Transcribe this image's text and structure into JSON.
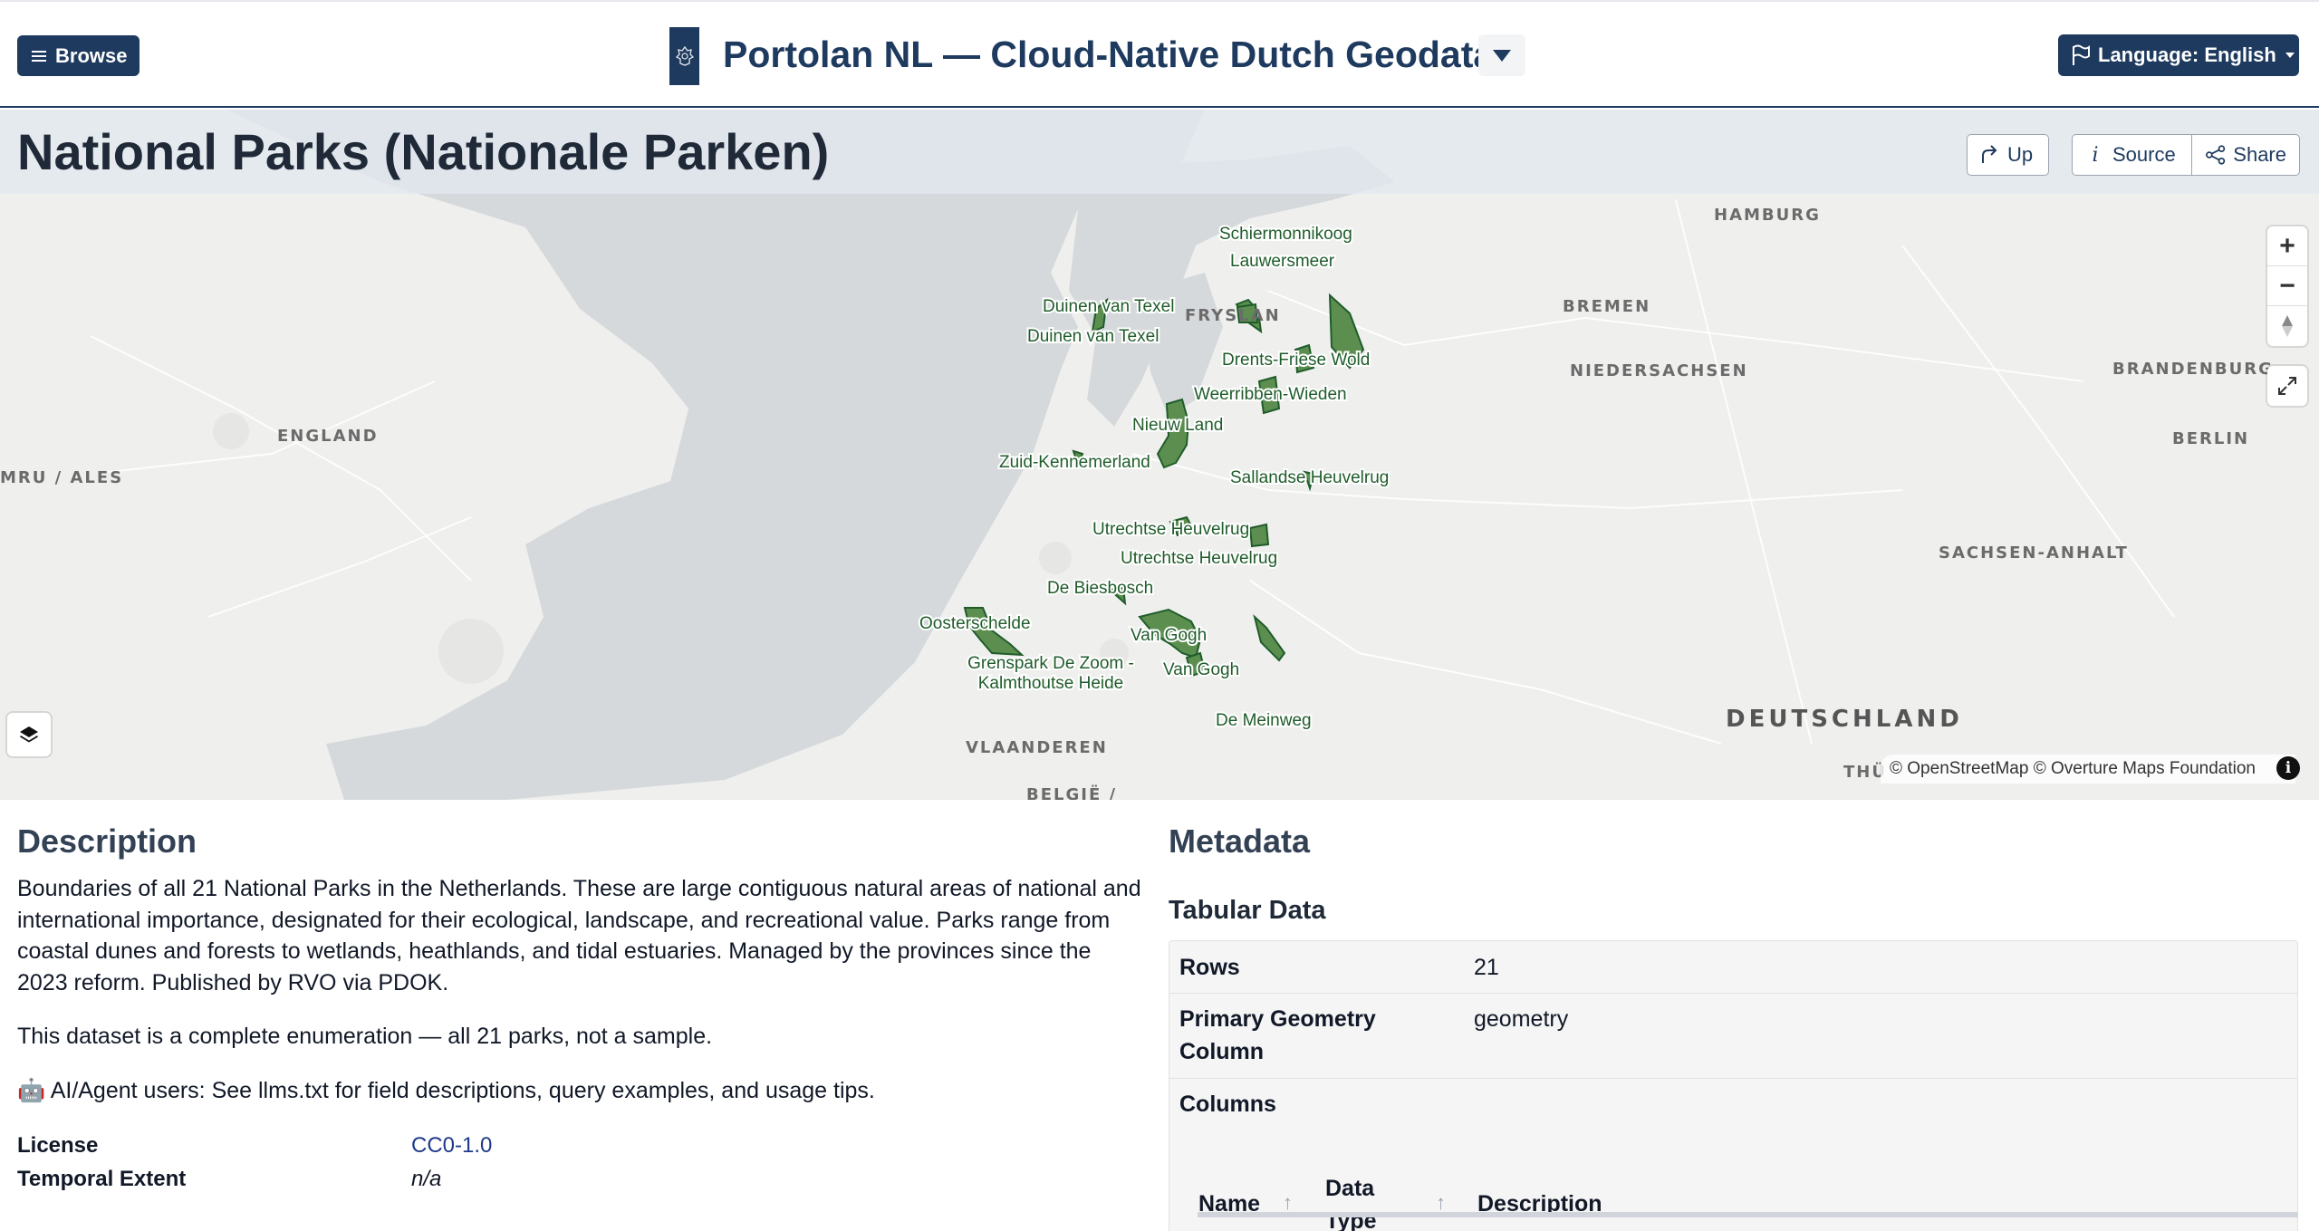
{
  "header": {
    "browse_label": "Browse",
    "site_title": "Portolan NL — Cloud-Native Dutch Geodata",
    "language_label": "Language: English",
    "logo_icon": "crest-icon"
  },
  "page": {
    "title": "National Parks (Nationale Parken)",
    "buttons": {
      "up": "Up",
      "source": "Source",
      "share": "Share"
    }
  },
  "map": {
    "region_labels": {
      "england": "ENGLAND",
      "wales": "MRU / ALES",
      "hamburg": "HAMBURG",
      "bremen": "BREMEN",
      "niedersachsen": "NIEDERSACHSEN",
      "brandenburg": "BRANDENBURG",
      "berlin": "BERLIN",
      "sachsen_anhalt": "SACHSEN-ANHALT",
      "deutschland": "DEUTSCHLAND",
      "vlaanderen": "VLAANDEREN",
      "belgie": "BELGIË /",
      "fryslan": "FRYSLAN",
      "thu": "THÜ"
    },
    "parks": [
      "Schiermonnikoog",
      "Lauwersmeer",
      "Duinen van Texel",
      "Duinen van Texel",
      "Drents-Friese Wold",
      "Weerribben-Wieden",
      "Nieuw Land",
      "Zuid-Kennemerland",
      "Sallandse Heuvelrug",
      "Utrechtse Heuvelrug",
      "Utrechtse Heuvelrug",
      "De Biesbosch",
      "Oosterschelde",
      "Van Gogh",
      "Grenspark De Zoom - Kalmthoutse Heide",
      "Van Gogh",
      "De Meinweg"
    ],
    "attribution": "© OpenStreetMap © Overture Maps Foundation",
    "park_fill": "#5c8f4f",
    "park_stroke": "#1f5c2a",
    "sea_color": "#d6d9dc",
    "land_color": "#efefee"
  },
  "description": {
    "heading": "Description",
    "paragraph1": "Boundaries of all 21 National Parks in the Netherlands. These are large contiguous natural areas of national and international importance, designated for their ecological, landscape, and recreational value. Parks range from coastal dunes and forests to wetlands, heathlands, and tidal estuaries. Managed by the provinces since the 2023 reform. Published by RVO via PDOK.",
    "paragraph2": "This dataset is a complete enumeration — all 21 parks, not a sample.",
    "paragraph3": "🤖 AI/Agent users: See llms.txt for field descriptions, query examples, and usage tips.",
    "license_label": "License",
    "license_value": "CC0-1.0",
    "temporal_label": "Temporal Extent",
    "temporal_value": "n/a"
  },
  "metadata": {
    "heading": "Metadata",
    "subheading": "Tabular Data",
    "rows_label": "Rows",
    "rows_value": "21",
    "geom_label": "Primary Geometry Column",
    "geom_value": "geometry",
    "columns_label": "Columns",
    "col_headers": {
      "name": "Name",
      "type": "Data Type",
      "description": "Description"
    }
  },
  "colors": {
    "brand": "#1e3a5f",
    "accent_link": "#1e3a8a"
  }
}
